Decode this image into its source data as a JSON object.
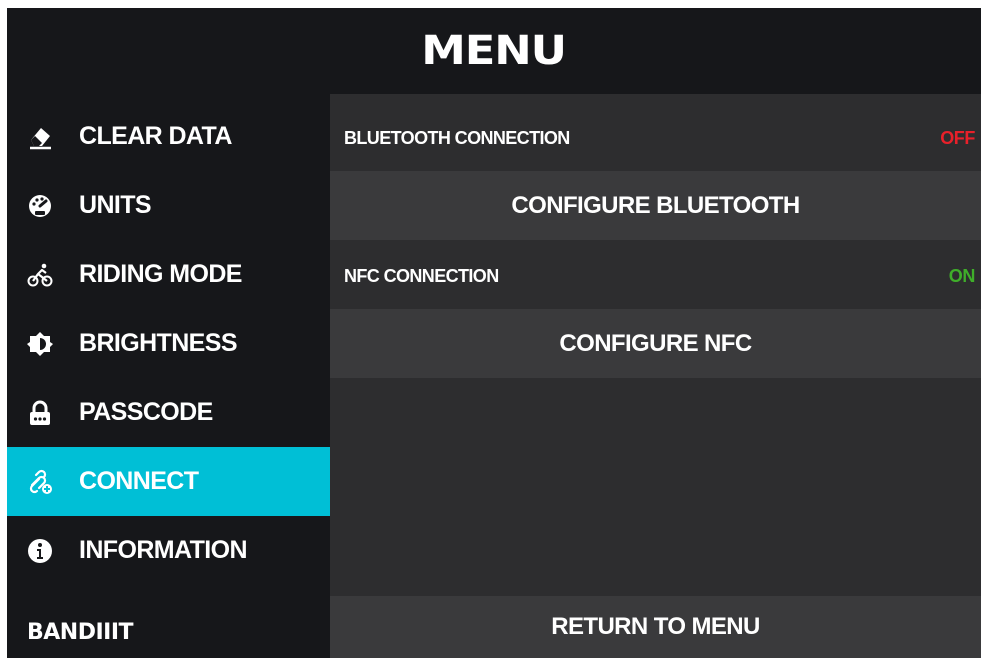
{
  "header": {
    "title": "MENU"
  },
  "sidebar": {
    "items": [
      {
        "label": "CLEAR DATA",
        "icon": "eraser-icon"
      },
      {
        "label": "UNITS",
        "icon": "speedometer-icon"
      },
      {
        "label": "RIDING MODE",
        "icon": "cyclist-icon"
      },
      {
        "label": "BRIGHTNESS",
        "icon": "brightness-icon"
      },
      {
        "label": "PASSCODE",
        "icon": "lock-icon"
      },
      {
        "label": "CONNECT",
        "icon": "link-plus-icon",
        "active": true
      },
      {
        "label": "INFORMATION",
        "icon": "info-icon"
      }
    ],
    "brand": "BANDIIIT"
  },
  "connect": {
    "bluetooth": {
      "label": "BLUETOOTH CONNECTION",
      "status": "OFF",
      "button": "CONFIGURE BLUETOOTH"
    },
    "nfc": {
      "label": "NFC CONNECTION",
      "status": "ON",
      "button": "CONFIGURE NFC"
    },
    "return_button": "RETURN TO MENU"
  },
  "colors": {
    "accent": "#00bfd6",
    "status_off": "#e8202a",
    "status_on": "#3fae2a",
    "background": "#16171a",
    "panel": "#2d2d2f"
  }
}
